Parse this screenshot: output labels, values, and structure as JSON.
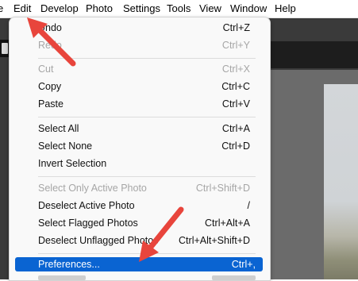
{
  "menubar": {
    "items": [
      "e",
      "Edit",
      "Develop",
      "Photo",
      "Settings",
      "Tools",
      "View",
      "Window",
      "Help"
    ]
  },
  "edit_menu": {
    "items": [
      {
        "label": "Undo",
        "shortcut": "Ctrl+Z",
        "enabled": true
      },
      {
        "label": "Redo",
        "shortcut": "Ctrl+Y",
        "enabled": false
      },
      {
        "label": "Cut",
        "shortcut": "Ctrl+X",
        "enabled": false
      },
      {
        "label": "Copy",
        "shortcut": "Ctrl+C",
        "enabled": true
      },
      {
        "label": "Paste",
        "shortcut": "Ctrl+V",
        "enabled": true
      },
      {
        "label": "Select All",
        "shortcut": "Ctrl+A",
        "enabled": true
      },
      {
        "label": "Select None",
        "shortcut": "Ctrl+D",
        "enabled": true
      },
      {
        "label": "Invert Selection",
        "shortcut": "",
        "enabled": true
      },
      {
        "label": "Select Only Active Photo",
        "shortcut": "Ctrl+Shift+D",
        "enabled": false
      },
      {
        "label": "Deselect Active Photo",
        "shortcut": "/",
        "enabled": true
      },
      {
        "label": "Select Flagged Photos",
        "shortcut": "Ctrl+Alt+A",
        "enabled": true
      },
      {
        "label": "Deselect Unflagged Photos",
        "shortcut": "Ctrl+Alt+Shift+D",
        "enabled": true
      },
      {
        "label": "Preferences...",
        "shortcut": "Ctrl+,",
        "enabled": true,
        "highlighted": true
      }
    ]
  },
  "annotations": {
    "arrow_color": "#e8453c"
  },
  "colors": {
    "highlight": "#0a64d2",
    "menu_bg": "#f9f9f9",
    "disabled_text": "#a6a6a6"
  }
}
